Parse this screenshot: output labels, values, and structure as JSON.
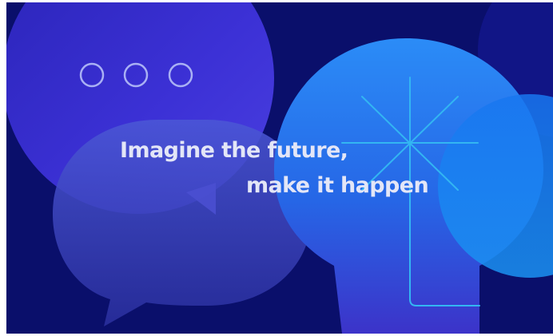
{
  "headline": {
    "line1": "Imagine the future,",
    "line2": "make it happen"
  },
  "colors": {
    "background": "#0a0f6b",
    "speech_bubble_top": "#3b2fd0",
    "speech_bubble_bottom": "#3a3fb8",
    "lightbulb": "#1f6ef0",
    "filament": "#2ea8f0",
    "text": "#e3e6f7"
  },
  "icons": {
    "typing_dots": "three-circle-outline-icon",
    "spark": "sparkle-filament-icon"
  }
}
